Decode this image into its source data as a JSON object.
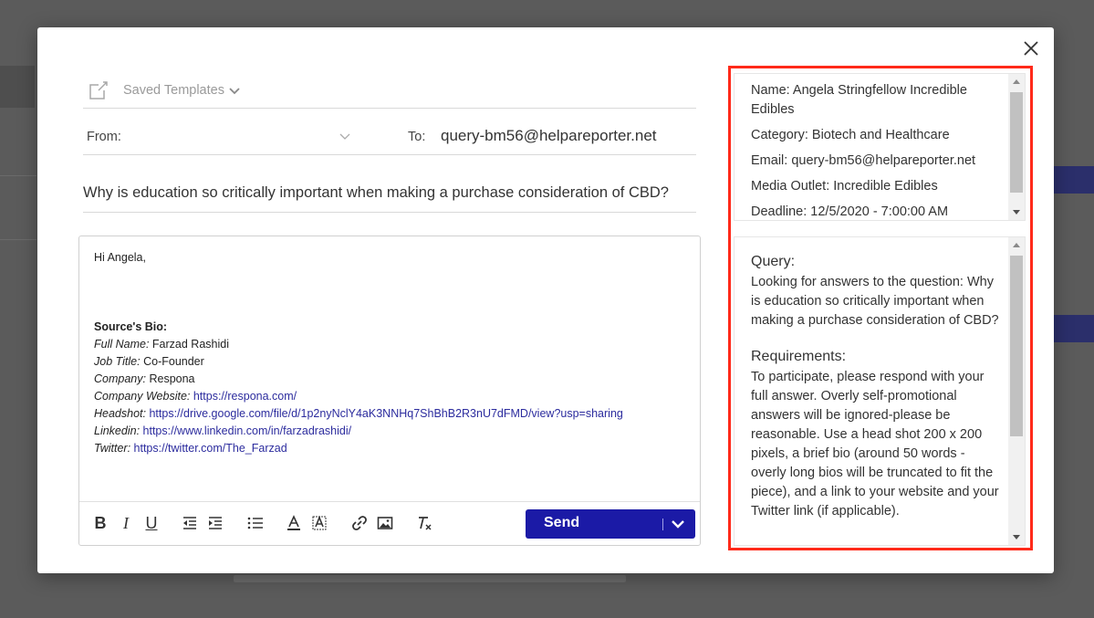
{
  "templates": {
    "label": "Saved Templates"
  },
  "compose": {
    "from_label": "From:",
    "to_label": "To:",
    "to_value": "query-bm56@helpareporter.net",
    "subject": "Why is education so critically important when making a purchase consideration of CBD?"
  },
  "editor": {
    "greeting": "Hi Angela,",
    "bio_heading": "Source's Bio:",
    "bio": [
      {
        "label": "Full Name:",
        "value": "Farzad Rashidi",
        "is_link": false
      },
      {
        "label": "Job Title:",
        "value": "Co-Founder",
        "is_link": false
      },
      {
        "label": "Company:",
        "value": "Respona",
        "is_link": false
      },
      {
        "label": "Company Website:",
        "value": "https://respona.com/",
        "is_link": true
      },
      {
        "label": "Headshot:",
        "value": "https://drive.google.com/file/d/1p2nyNclY4aK3NNHq7ShBhB2R3nU7dFMD/view?usp=sharing",
        "is_link": true
      },
      {
        "label": "Linkedin:",
        "value": "https://www.linkedin.com/in/farzadrashidi/",
        "is_link": true
      },
      {
        "label": "Twitter:",
        "value": "https://twitter.com/The_Farzad",
        "is_link": true
      }
    ]
  },
  "toolbar": {
    "bold": "B",
    "italic": "I",
    "underline": "U",
    "clear_format": "Tx",
    "send_label": "Send"
  },
  "info": {
    "name": "Name: Angela Stringfellow Incredible Edibles",
    "category": "Category: Biotech and Healthcare",
    "email": "Email: query-bm56@helpareporter.net",
    "outlet": "Media Outlet: Incredible Edibles",
    "deadline": "Deadline: 12/5/2020 - 7:00:00 AM"
  },
  "query": {
    "query_heading": "Query:",
    "query_text": "Looking for answers to the question: Why is education so critically important when making a purchase consideration of CBD?",
    "req_heading": "Requirements:",
    "req_text": "To participate, please respond with your full answer. Overly self-promotional answers will be ignored-please be reasonable. Use a head shot 200 x 200 pixels, a brief bio (around 50 words - overly long bios will be truncated to fit the piece), and a link to your website and your Twitter link (if applicable)."
  },
  "colors": {
    "accent": "#1b1aa6",
    "highlight": "#ff2a1a",
    "link": "#2c2c9e"
  }
}
